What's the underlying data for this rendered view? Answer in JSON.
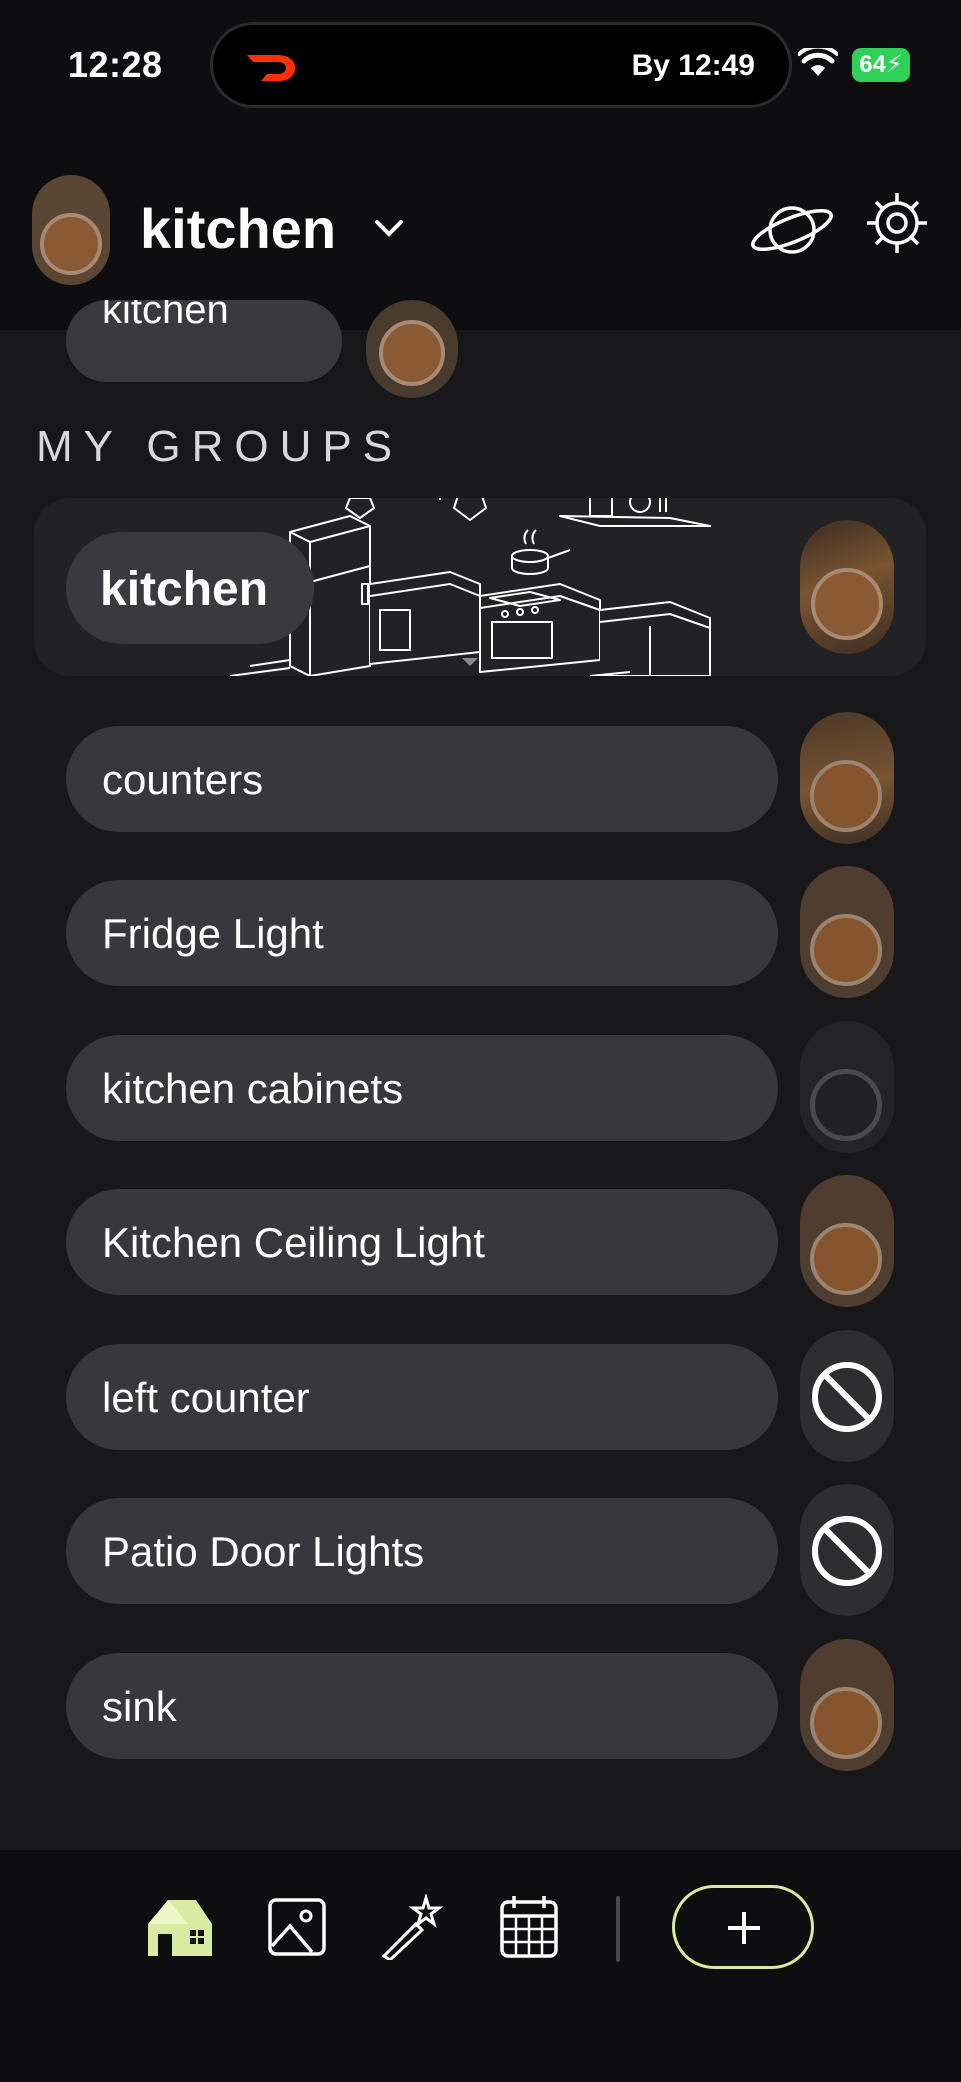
{
  "status_bar": {
    "time": "12:28",
    "activity": "By 12:49",
    "battery": "64"
  },
  "header": {
    "title": "kitchen"
  },
  "scrolled_row": {
    "label": "kitchen"
  },
  "section": {
    "label": "MY GROUPS"
  },
  "group": {
    "label": "kitchen"
  },
  "devices": [
    {
      "label": "counters",
      "state": "on"
    },
    {
      "label": "Fridge Light",
      "state": "on"
    },
    {
      "label": "kitchen cabinets",
      "state": "off"
    },
    {
      "label": "Kitchen Ceiling Light",
      "state": "on"
    },
    {
      "label": "left counter",
      "state": "unreachable"
    },
    {
      "label": "Patio Door Lights",
      "state": "unreachable"
    },
    {
      "label": "sink",
      "state": "on"
    }
  ],
  "nav": {
    "items": [
      "home-icon",
      "image-icon",
      "magic-wand-icon",
      "calendar-icon"
    ],
    "add_icon": "plus-icon"
  },
  "colors": {
    "accent": "#d9eba0",
    "warm_light": "#85552f",
    "pill": "#38383c"
  }
}
